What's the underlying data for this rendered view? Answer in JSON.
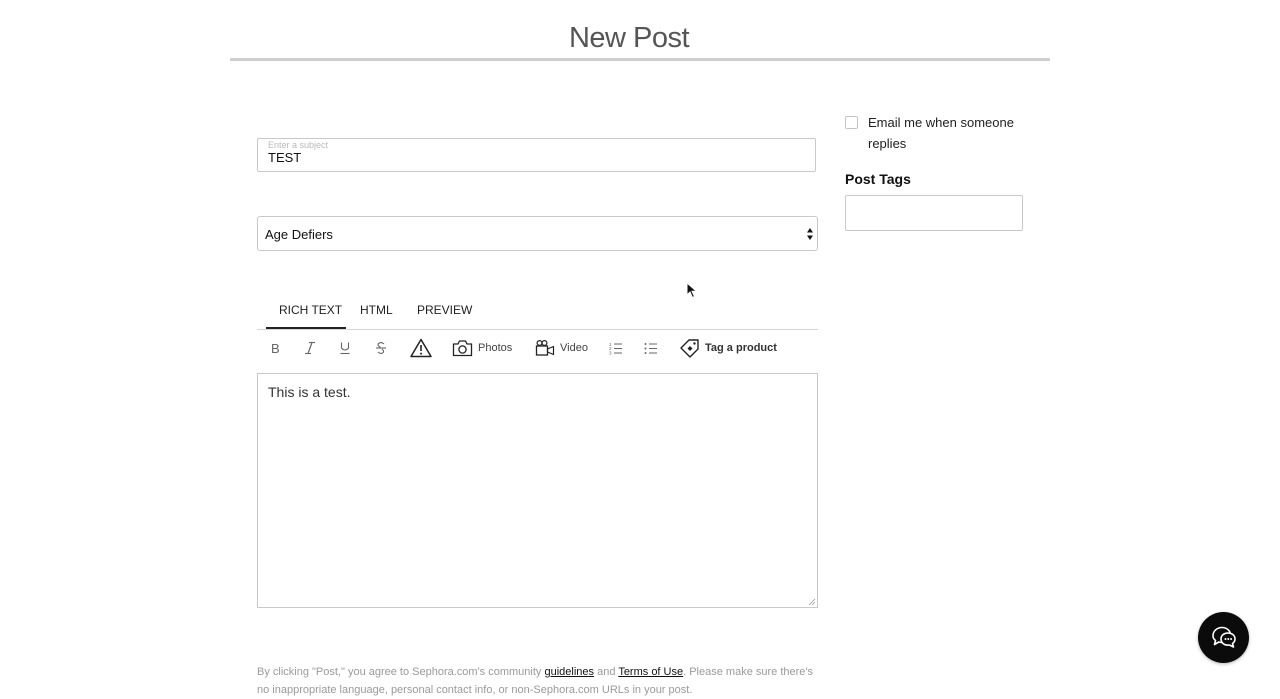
{
  "page": {
    "title": "New Post"
  },
  "subject": {
    "label": "Enter a subject",
    "value": "TEST"
  },
  "board_select": {
    "value": "Age Defiers"
  },
  "editor_tabs": [
    {
      "label": "RICH TEXT",
      "active": true
    },
    {
      "label": "HTML",
      "active": false
    },
    {
      "label": "PREVIEW",
      "active": false
    }
  ],
  "toolbar": {
    "bold_icon": "bold-icon",
    "italic_icon": "italic-icon",
    "underline_icon": "underline-icon",
    "strikethrough_icon": "strikethrough-icon",
    "spoiler_icon": "warning-icon",
    "photos_label": "Photos",
    "video_label": "Video",
    "ordered_list_icon": "ordered-list-icon",
    "bulleted_list_icon": "bulleted-list-icon",
    "tag_product_label": "Tag a product"
  },
  "editor": {
    "body": "This is a test."
  },
  "sidebar": {
    "email_label": "Email me when someone replies",
    "email_checked": false,
    "tags_heading": "Post Tags",
    "tags_value": ""
  },
  "notice": {
    "part1": "By clicking \"Post,\" you agree to Sephora.com's community ",
    "guidelines_link": "guidelines",
    "part2": " and ",
    "terms_link": "Terms of Use",
    "part3": ". Please make sure there's no inappropriate language, personal contact info, or non-Sephora.com URLs in your post."
  },
  "colors": {
    "accent": "#222222",
    "chat_button": "#0b0b0b",
    "muted_text": "#9a9a9a"
  }
}
